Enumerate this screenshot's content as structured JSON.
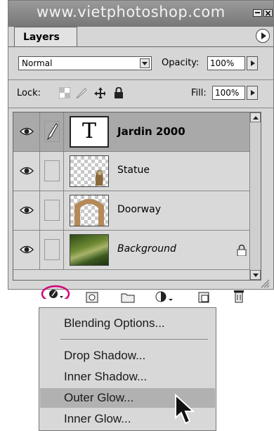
{
  "title_bar": {
    "watermark": "www.vietphotoshop.com"
  },
  "panel": {
    "tab_label": "Layers",
    "blend_mode": "Normal",
    "opacity_label": "Opacity:",
    "opacity_value": "100%",
    "lock_label": "Lock:",
    "fill_label": "Fill:",
    "fill_value": "100%"
  },
  "layers": [
    {
      "name": "Jardin 2000",
      "thumbnail": "T",
      "visible": true,
      "active": true,
      "locked": false,
      "style": "bold"
    },
    {
      "name": "Statue",
      "visible": true,
      "active": false,
      "locked": false,
      "style": "normal"
    },
    {
      "name": "Doorway",
      "visible": true,
      "active": false,
      "locked": false,
      "style": "normal"
    },
    {
      "name": "Background",
      "visible": true,
      "active": false,
      "locked": true,
      "style": "italic"
    }
  ],
  "context_menu": {
    "items": [
      {
        "label": "Blending Options..."
      },
      {
        "label": "Drop Shadow..."
      },
      {
        "label": "Inner Shadow..."
      },
      {
        "label": "Outer Glow...",
        "highlighted": true
      },
      {
        "label": "Inner Glow..."
      }
    ]
  },
  "colors": {
    "panel_bg": "#d6d6d6",
    "active_row": "#a9a9a9",
    "highlight_circle": "#d4007c",
    "menu_highlight": "#b1b1b1"
  }
}
